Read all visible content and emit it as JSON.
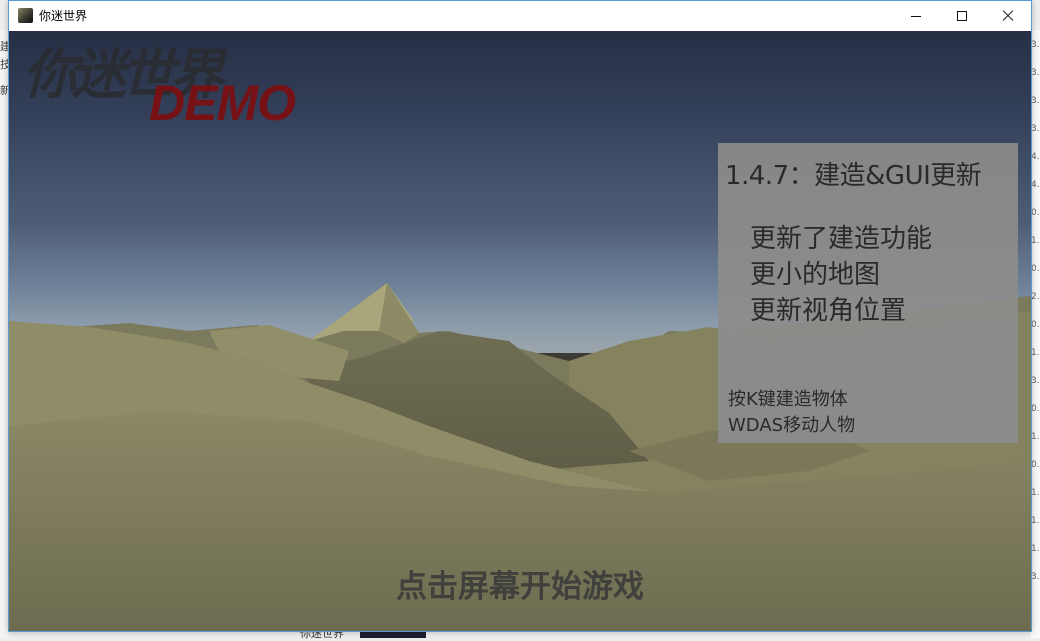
{
  "window": {
    "title": "你迷世界",
    "controls": [
      "minimize",
      "maximize",
      "close"
    ]
  },
  "logo": {
    "title": "你迷世界",
    "subtitle": "DEMO"
  },
  "info_panel": {
    "version_title": "1.4.7：建造&GUI更新",
    "updates": [
      "更新了建造功能",
      "更小的地图",
      "更新视角位置"
    ],
    "hints": [
      "按K键建造物体",
      "WDAS移动人物"
    ]
  },
  "start_prompt": "点击屏幕开始游戏",
  "background_fragments": {
    "left_chars": [
      "建",
      "技",
      "新"
    ],
    "right_numbers": [
      "3.",
      "3.",
      "3.",
      "3.",
      "4.",
      "4.",
      "0.",
      "1.",
      "0.",
      "2.",
      "0.",
      "1.",
      "3.",
      "0.",
      "1.",
      "0.",
      "1.",
      "1.",
      "1.",
      "3."
    ],
    "bottom_item": "你迷世界"
  },
  "colors": {
    "sky_top": "#262f44",
    "horizon": "#9aa4ad",
    "terrain": "#807e60",
    "logo_dark": "#2a2c30",
    "logo_red": "#7a1012",
    "panel_bg": "#8c8c8c",
    "window_border": "#5b9bd5"
  }
}
